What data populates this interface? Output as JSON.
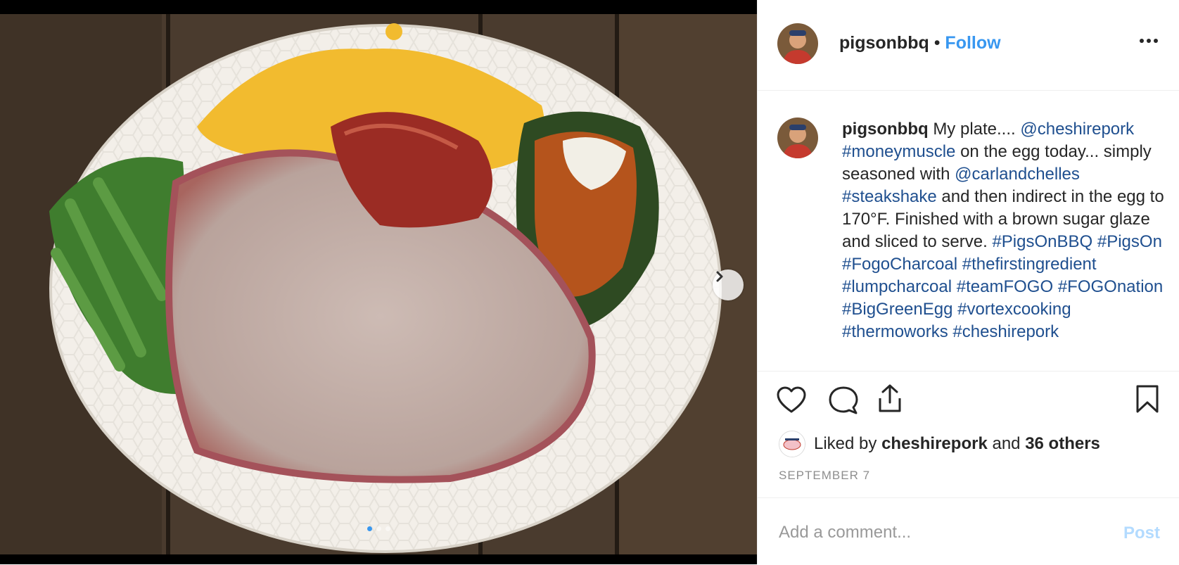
{
  "post": {
    "username": "pigsonbbq",
    "separator": "•",
    "follow_label": "Follow",
    "more_icon": "more-horizontal-icon",
    "caption": [
      {
        "t": "My plate.... ",
        "link": false
      },
      {
        "t": "@cheshirepork",
        "link": true
      },
      {
        "t": " ",
        "link": false
      },
      {
        "t": "#moneymuscle",
        "link": true
      },
      {
        "t": " on the egg today... simply seasoned with ",
        "link": false
      },
      {
        "t": "@carlandchelles",
        "link": true
      },
      {
        "t": " ",
        "link": false
      },
      {
        "t": "#steakshake",
        "link": true
      },
      {
        "t": " and then indirect in the egg to 170°F. Finished with a brown sugar glaze and sliced to serve. ",
        "link": false
      },
      {
        "t": "#PigsOnBBQ",
        "link": true
      },
      {
        "t": " ",
        "link": false
      },
      {
        "t": "#PigsOn",
        "link": true
      },
      {
        "t": " ",
        "link": false
      },
      {
        "t": "#FogoCharcoal",
        "link": true
      },
      {
        "t": " ",
        "link": false
      },
      {
        "t": "#thefirstingredient",
        "link": true
      },
      {
        "t": " ",
        "link": false
      },
      {
        "t": "#lumpcharcoal",
        "link": true
      },
      {
        "t": " ",
        "link": false
      },
      {
        "t": "#teamFOGO",
        "link": true
      },
      {
        "t": " ",
        "link": false
      },
      {
        "t": "#FOGOnation",
        "link": true
      },
      {
        "t": " ",
        "link": false
      },
      {
        "t": "#BigGreenEgg",
        "link": true
      },
      {
        "t": " ",
        "link": false
      },
      {
        "t": "#vortexcooking",
        "link": true
      },
      {
        "t": " ",
        "link": false
      },
      {
        "t": "#thermoworks",
        "link": true
      },
      {
        "t": " ",
        "link": false
      },
      {
        "t": "#cheshirepork",
        "link": true
      }
    ],
    "likes": {
      "prefix": "Liked by ",
      "user": "cheshirepork",
      "middle": " and ",
      "others": "36 others"
    },
    "date": "SEPTEMBER 7",
    "comment_placeholder": "Add a comment...",
    "post_label": "Post",
    "carousel": {
      "total": 3,
      "active": 0
    }
  },
  "colors": {
    "link": "#1f4f8f",
    "follow": "#3897f0",
    "post_disabled": "#b3dbff",
    "muted": "#8e8e8e"
  }
}
